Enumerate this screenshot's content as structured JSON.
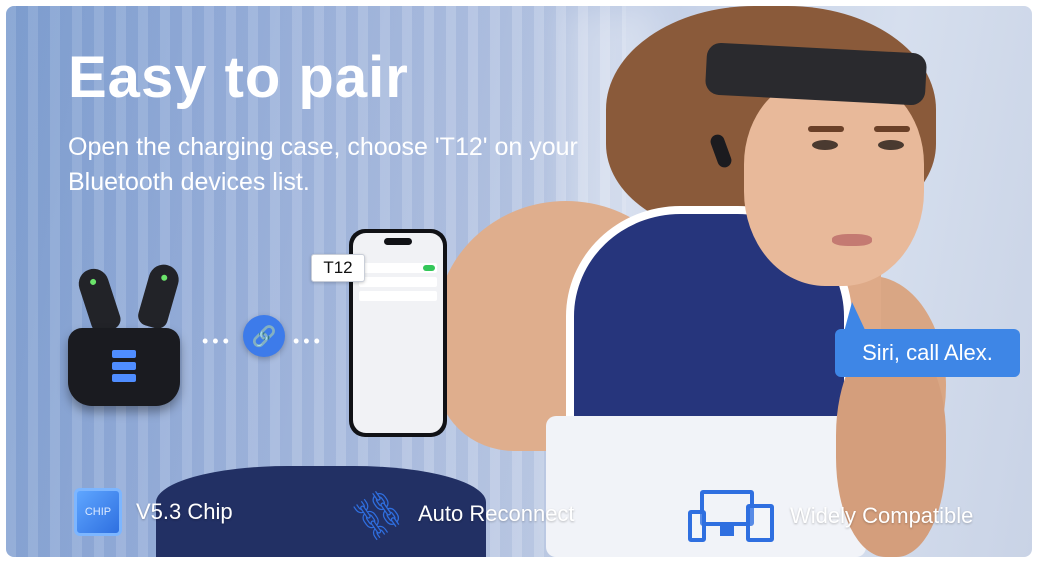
{
  "banner": {
    "headline": "Easy to pair",
    "subtitle": "Open the charging case, choose 'T12' on your Bluetooth devices list.",
    "device_label": "T12",
    "speech_bubble": "Siri, call Alex.",
    "chip_icon_text": "CHIP"
  },
  "features": [
    {
      "label": "V5.3 Chip",
      "icon": "chip-icon"
    },
    {
      "label": "Auto Reconnect",
      "icon": "chain-link-icon"
    },
    {
      "label": "Widely Compatible",
      "icon": "devices-icon"
    }
  ],
  "colors": {
    "accent_blue": "#3e86e6",
    "text": "#ffffff",
    "top_navy": "#26357c"
  }
}
